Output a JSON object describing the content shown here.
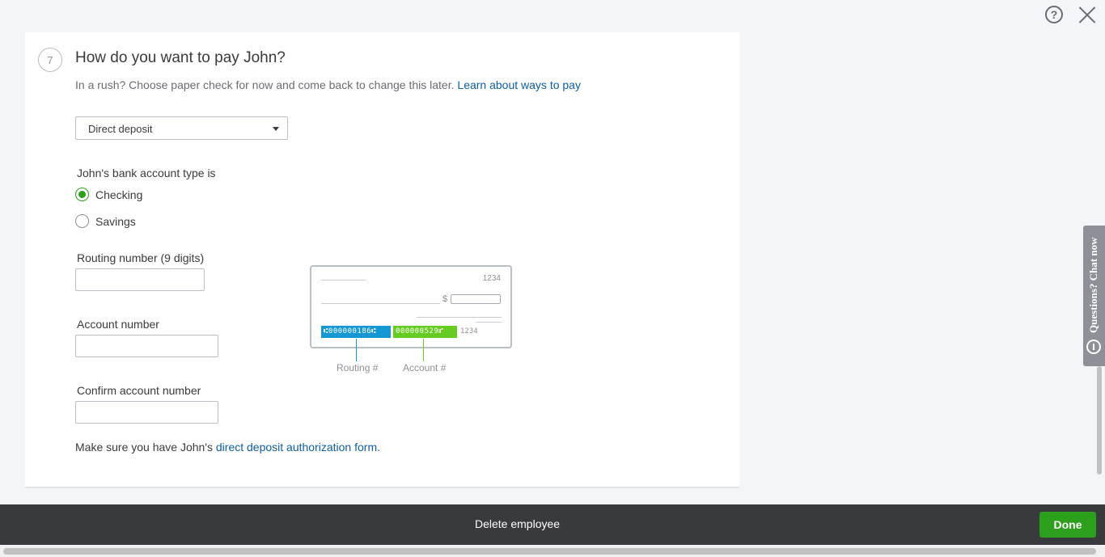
{
  "header": {
    "help_icon": "help-icon",
    "close_icon": "close-icon"
  },
  "section": {
    "step_number": "7",
    "title": "How do you want to pay John?",
    "subtitle": "In a rush? Choose paper check for now and come back to change this later.",
    "learn_link": "Learn about ways to pay"
  },
  "payment_method": {
    "selected": "Direct deposit"
  },
  "account_type": {
    "label": "John's bank account type is",
    "options": [
      {
        "label": "Checking",
        "checked": true
      },
      {
        "label": "Savings",
        "checked": false
      }
    ]
  },
  "routing": {
    "label": "Routing number (9 digits)",
    "value": ""
  },
  "account": {
    "label": "Account number",
    "value": ""
  },
  "confirm_account": {
    "label": "Confirm account number",
    "value": ""
  },
  "check_illustration": {
    "check_number": "1234",
    "dollar_sign": "$",
    "routing_micr": "⑆000000186⑆",
    "account_micr": "000000529⑈",
    "check_micr": "1234",
    "routing_caption": "Routing #",
    "account_caption": "Account #"
  },
  "note": {
    "prefix": "Make sure you have John's",
    "link": "direct deposit authorization form."
  },
  "chat_tab": {
    "label": "Questions? Chat now"
  },
  "footer": {
    "delete_label": "Delete employee",
    "done_label": "Done",
    "done_color": "#2ca01c"
  }
}
